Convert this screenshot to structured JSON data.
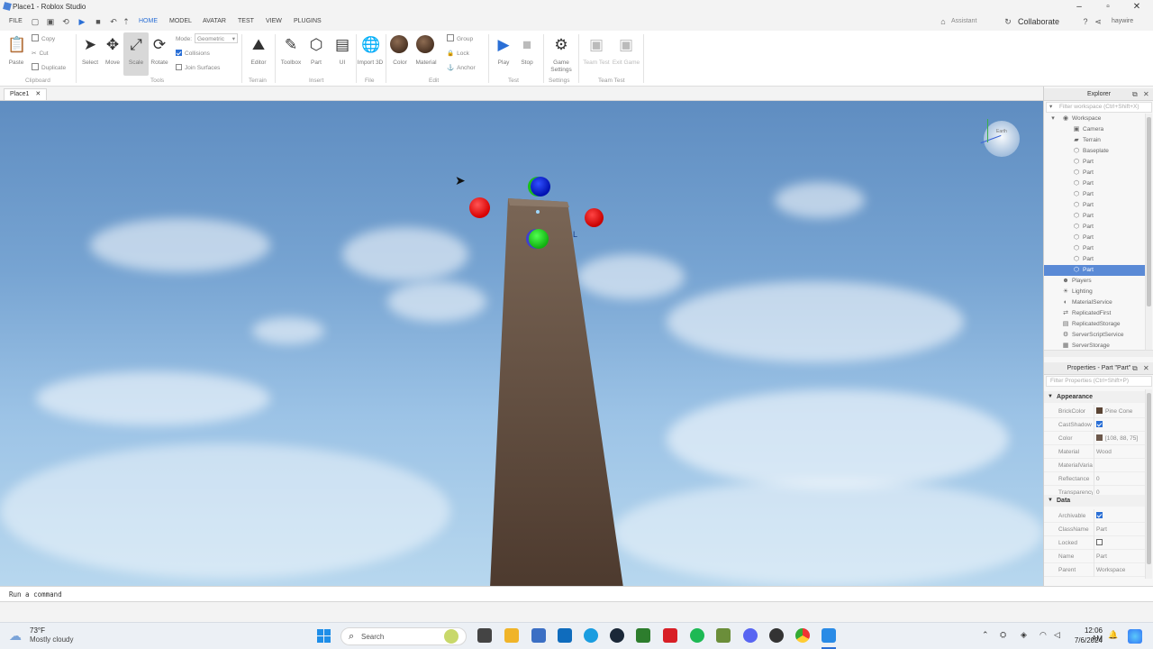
{
  "window": {
    "title": "Place1 - Roblox Studio",
    "assistant_label": "Assistant",
    "collaborate_label": "Collaborate",
    "username": "haywire"
  },
  "menu": {
    "file": "FILE",
    "tabs": [
      "HOME",
      "MODEL",
      "AVATAR",
      "TEST",
      "VIEW",
      "PLUGINS"
    ],
    "active_tab": "HOME"
  },
  "ribbon": {
    "clipboard": {
      "paste": "Paste",
      "copy": "Copy",
      "cut": "Cut",
      "duplicate": "Duplicate",
      "group": "Clipboard"
    },
    "tools": {
      "select": "Select",
      "move": "Move",
      "scale": "Scale",
      "rotate": "Rotate",
      "mode_label": "Mode:",
      "mode_value": "Geometric",
      "collisions": "Collisions",
      "join_surfaces": "Join Surfaces",
      "group": "Tools"
    },
    "terrain": {
      "editor": "Editor",
      "group": "Terrain"
    },
    "insert": {
      "toolbox": "Toolbox",
      "part": "Part",
      "ui": "UI",
      "group": "Insert"
    },
    "file": {
      "import_3d": "Import 3D",
      "group": "File"
    },
    "edit": {
      "color": "Color",
      "material": "Material",
      "group_btn": "Group",
      "lock": "Lock",
      "anchor": "Anchor",
      "group": "Edit"
    },
    "test": {
      "play": "Play",
      "stop": "Stop",
      "group": "Test"
    },
    "settings": {
      "game_settings": "Game Settings",
      "group": "Settings"
    },
    "team_test": {
      "team_test": "Team Test",
      "exit_game": "Exit Game",
      "group": "Team Test"
    }
  },
  "doc_tab": {
    "label": "Place1"
  },
  "viewport": {
    "viewcube_label": "Earth"
  },
  "explorer": {
    "title": "Explorer",
    "filter_placeholder": "Filter workspace (Ctrl+Shift+X)",
    "items": [
      {
        "label": "Workspace",
        "icon": "workspace-icon",
        "depth": 0,
        "expanded": true
      },
      {
        "label": "Camera",
        "icon": "camera-icon",
        "depth": 1
      },
      {
        "label": "Terrain",
        "icon": "terrain-icon",
        "depth": 1
      },
      {
        "label": "Baseplate",
        "icon": "part-icon",
        "depth": 1
      },
      {
        "label": "Part",
        "icon": "part-icon",
        "depth": 1
      },
      {
        "label": "Part",
        "icon": "part-icon",
        "depth": 1
      },
      {
        "label": "Part",
        "icon": "part-icon",
        "depth": 1
      },
      {
        "label": "Part",
        "icon": "part-icon",
        "depth": 1
      },
      {
        "label": "Part",
        "icon": "part-icon",
        "depth": 1
      },
      {
        "label": "Part",
        "icon": "part-icon",
        "depth": 1
      },
      {
        "label": "Part",
        "icon": "part-icon",
        "depth": 1
      },
      {
        "label": "Part",
        "icon": "part-icon",
        "depth": 1
      },
      {
        "label": "Part",
        "icon": "part-icon",
        "depth": 1
      },
      {
        "label": "Part",
        "icon": "part-icon",
        "depth": 1
      },
      {
        "label": "Part",
        "icon": "part-icon",
        "depth": 1,
        "selected": true
      },
      {
        "label": "Players",
        "icon": "players-icon",
        "depth": 0
      },
      {
        "label": "Lighting",
        "icon": "lighting-icon",
        "depth": 0
      },
      {
        "label": "MaterialService",
        "icon": "material-service-icon",
        "depth": 0
      },
      {
        "label": "ReplicatedFirst",
        "icon": "replicated-first-icon",
        "depth": 0
      },
      {
        "label": "ReplicatedStorage",
        "icon": "replicated-storage-icon",
        "depth": 0
      },
      {
        "label": "ServerScriptService",
        "icon": "server-script-service-icon",
        "depth": 0
      },
      {
        "label": "ServerStorage",
        "icon": "server-storage-icon",
        "depth": 0
      }
    ]
  },
  "properties": {
    "title": "Properties - Part \"Part\"",
    "filter_placeholder": "Filter Properties (Ctrl+Shift+P)",
    "appearance": {
      "title": "Appearance",
      "rows": [
        {
          "name": "BrickColor",
          "value": "Pine Cone",
          "swatch": "#5a4434"
        },
        {
          "name": "CastShadow",
          "checked": true
        },
        {
          "name": "Color",
          "value": "[108, 88, 75]",
          "swatch": "#6c584b"
        },
        {
          "name": "Material",
          "value": "Wood"
        },
        {
          "name": "MaterialVariant",
          "value": ""
        },
        {
          "name": "Reflectance",
          "value": "0"
        },
        {
          "name": "Transparency",
          "value": "0"
        }
      ]
    },
    "data": {
      "title": "Data",
      "rows": [
        {
          "name": "Archivable",
          "checked": true
        },
        {
          "name": "ClassName",
          "value": "Part"
        },
        {
          "name": "Locked",
          "checked": false
        },
        {
          "name": "Name",
          "value": "Part"
        },
        {
          "name": "Parent",
          "value": "Workspace"
        }
      ]
    }
  },
  "command_bar": {
    "placeholder": "Run a command"
  },
  "taskbar": {
    "weather_temp": "73°F",
    "weather_desc": "Mostly cloudy",
    "search_label": "Search",
    "time": "12:06 AM",
    "date": "7/6/2024"
  },
  "colors": {
    "accent": "#2a6fd6",
    "selection": "#5a8ad6",
    "part_brown": "#6c584b"
  }
}
